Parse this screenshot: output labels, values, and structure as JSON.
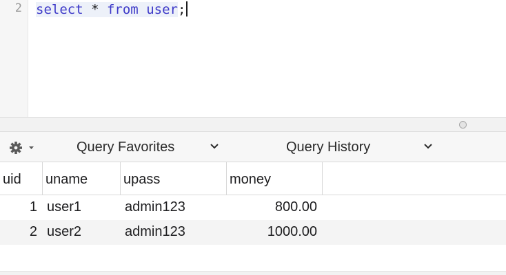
{
  "editor": {
    "line_number": "2",
    "code": {
      "kw_select": "select",
      "star": " * ",
      "kw_from": "from",
      "space": " ",
      "table": "user",
      "semicolon": ";"
    }
  },
  "toolbar": {
    "gear_icon": "gear-icon",
    "favorites_label": "Query Favorites",
    "history_label": "Query History"
  },
  "colors": {
    "keyword": "#3d39c8",
    "code_highlight": "#edf1f9",
    "alt_row": "#f4f4f4"
  },
  "results": {
    "columns": [
      "uid",
      "uname",
      "upass",
      "money"
    ],
    "rows": [
      [
        "1",
        "user1",
        "admin123",
        "800.00"
      ],
      [
        "2",
        "user2",
        "admin123",
        "1000.00"
      ]
    ]
  }
}
